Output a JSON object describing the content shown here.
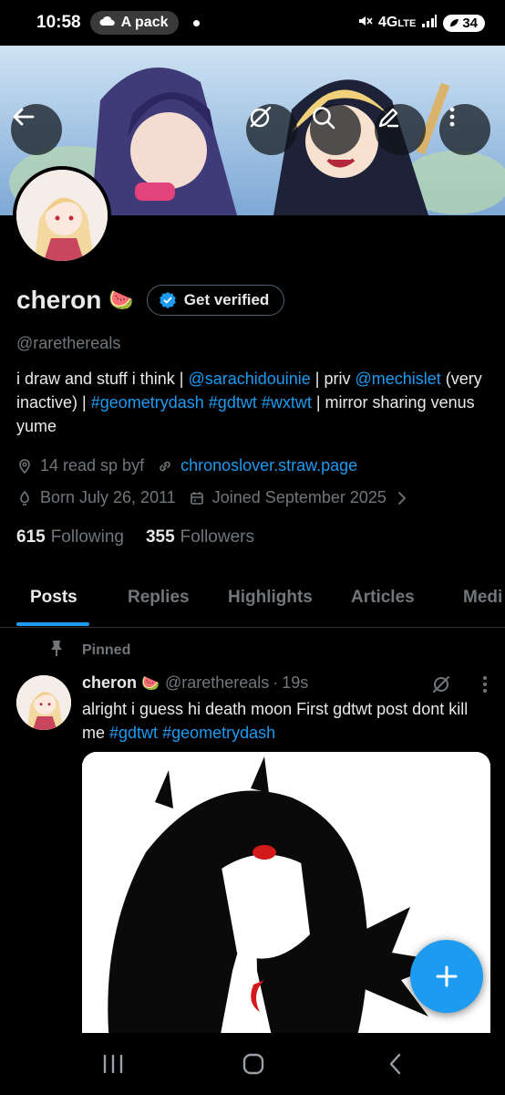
{
  "status_bar": {
    "time": "10:58",
    "notification_pill": "A pack",
    "network": "4G",
    "network_sub": "LTE",
    "battery": "34"
  },
  "profile": {
    "display_name": "cheron",
    "name_emoji": "🍉",
    "verify_label": "Get verified",
    "handle": "@rarethereals",
    "bio": {
      "p1": "i draw and stuff i think | ",
      "mention1": "@sarachidouinie",
      "p2": " | priv ",
      "mention2": "@mechislet",
      "p3": " (very inactive) | ",
      "tag1": "#geometrydash",
      "tag2": "#gdtwt",
      "tag3": "#wxtwt",
      "p4": " | mirror sharing venus yume"
    },
    "location": "14 read sp byf",
    "website": "chronoslover.straw.page",
    "born": "Born July 26, 2011",
    "joined": "Joined September 2025",
    "following_count": "615",
    "following_label": "Following",
    "followers_count": "355",
    "followers_label": "Followers"
  },
  "tabs": [
    {
      "label": "Posts",
      "active": true
    },
    {
      "label": "Replies"
    },
    {
      "label": "Highlights"
    },
    {
      "label": "Articles"
    },
    {
      "label": "Medi"
    }
  ],
  "pinned_post": {
    "pinned_label": "Pinned",
    "author_name": "cheron",
    "author_emoji": "🍉",
    "author_handle": "@rarethereals",
    "dot": "·",
    "time": "19s",
    "text": "alright i guess hi death moon First gdtwt post dont kill me ",
    "tag1": "#gdtwt",
    "tag2": "#geometrydash"
  },
  "colors": {
    "accent": "#1d9bf0",
    "muted": "#71767b",
    "text": "#e7e9ea",
    "background": "#000000"
  },
  "icons": [
    "back-arrow-icon",
    "grok-icon",
    "search-icon",
    "edit-icon",
    "more-vertical-icon",
    "verified-badge-icon",
    "location-icon",
    "link-icon",
    "birthday-icon",
    "calendar-icon",
    "chevron-right-icon",
    "pin-icon",
    "plus-icon",
    "recents-icon",
    "home-icon",
    "back-icon"
  ]
}
